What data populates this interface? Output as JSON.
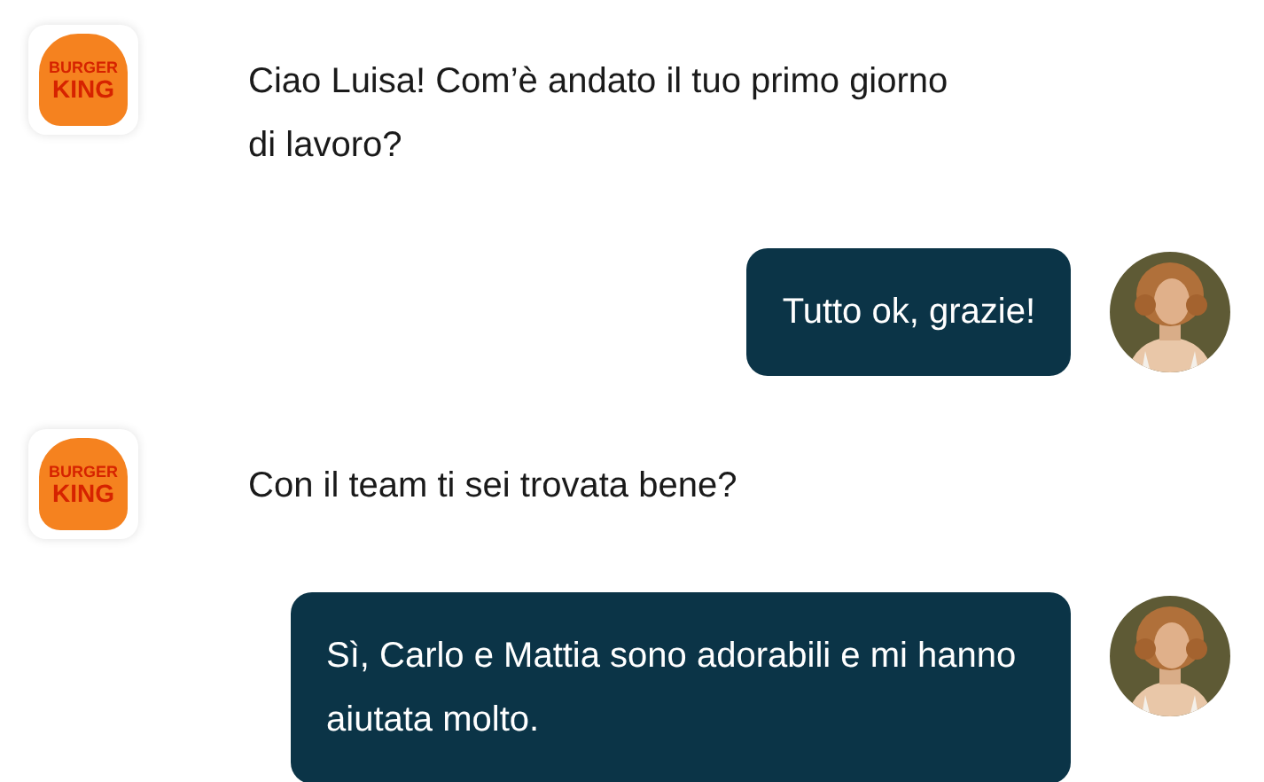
{
  "messages": [
    {
      "kind": "brand",
      "logo": [
        "BURGER",
        "KING"
      ],
      "text": "Ciao Luisa! Com’è andato il tuo primo giorno di lavoro?"
    },
    {
      "kind": "user",
      "text": "Tutto ok, grazie!"
    },
    {
      "kind": "brand",
      "logo": [
        "BURGER",
        "KING"
      ],
      "text": "Con il team ti sei trovata bene?"
    },
    {
      "kind": "user",
      "text": "Sì, Carlo e Mattia sono adorabili e mi hanno aiutata molto."
    }
  ]
}
